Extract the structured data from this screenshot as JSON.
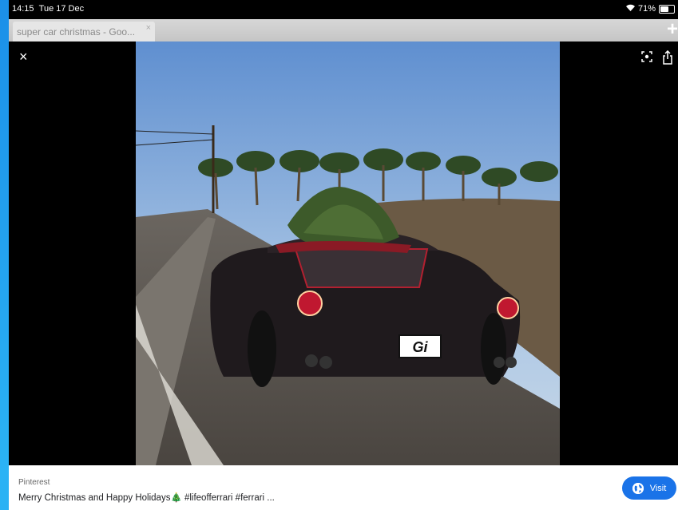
{
  "status": {
    "time": "14:15",
    "date": "Tue 17 Dec",
    "battery": "71%",
    "battery_level": 0.71
  },
  "tabs": [
    {
      "title": "super car christmas - Goo...",
      "close": "×"
    }
  ],
  "newtab_label": "+",
  "viewer": {
    "close": "×"
  },
  "caption": {
    "source": "Pinterest",
    "description": "Merry Christmas and Happy Holidays🎄 #lifeofferrari #ferrari ...",
    "visit_label": "Visit"
  },
  "colors": {
    "accent": "#1a73e8",
    "background": "#000000"
  },
  "icons": [
    "close-icon",
    "lens-icon",
    "share-icon",
    "globe-icon",
    "wifi-icon",
    "battery-icon"
  ]
}
